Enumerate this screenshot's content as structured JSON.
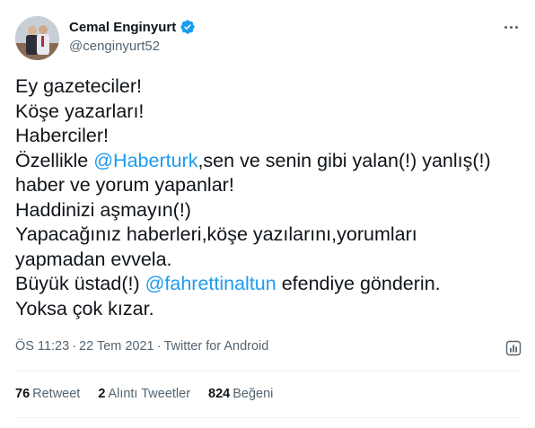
{
  "author": {
    "display_name": "Cemal Enginyurt",
    "handle": "@cenginyurt52"
  },
  "tweet": {
    "lines": [
      [
        {
          "text": "Ey gazeteciler!"
        }
      ],
      [
        {
          "text": "Köşe yazarları!"
        }
      ],
      [
        {
          "text": "Haberciler!"
        }
      ],
      [
        {
          "text": "Özellikle "
        },
        {
          "text": "@Haberturk",
          "mention": true
        },
        {
          "text": ",sen ve senin gibi yalan(!) yanlış(!)"
        }
      ],
      [
        {
          "text": "haber ve yorum yapanlar!"
        }
      ],
      [
        {
          "text": "Haddinizi aşmayın(!)"
        }
      ],
      [
        {
          "text": "Yapacağınız haberleri,köşe yazılarını,yorumları"
        }
      ],
      [
        {
          "text": "yapmadan evvela."
        }
      ],
      [
        {
          "text": "Büyük üstad(!) "
        },
        {
          "text": "@fahrettinaltun",
          "mention": true
        },
        {
          "text": " efendiye gönderin."
        }
      ],
      [
        {
          "text": "Yoksa çok kızar."
        }
      ]
    ]
  },
  "meta": {
    "time": "ÖS 11:23",
    "separator": "·",
    "date": "22 Tem 2021",
    "source": "Twitter for Android"
  },
  "stats": {
    "retweets": {
      "count": "76",
      "label": "Retweet"
    },
    "quotes": {
      "count": "2",
      "label": "Alıntı Tweetler"
    },
    "likes": {
      "count": "824",
      "label": "Beğeni"
    }
  },
  "colors": {
    "accent": "#1d9bf0",
    "secondary_text": "#536471",
    "primary_text": "#0f1419"
  },
  "icons": {
    "verified": "verified-badge-icon",
    "more": "more-options-icon",
    "analytics": "analytics-icon"
  }
}
